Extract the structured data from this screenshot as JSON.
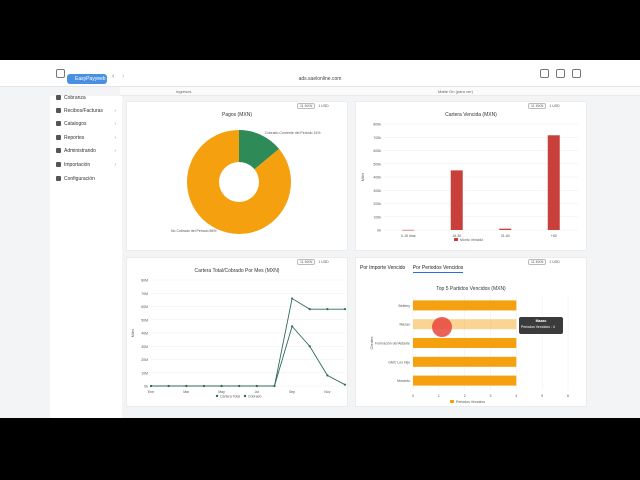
{
  "browser": {
    "tab_label": "EasyPayyeeb",
    "url": "ads.saelonline.com",
    "sub_left": "Ingresos",
    "sub_mid": "Matte On (para ver)"
  },
  "sidebar": {
    "items": [
      {
        "label": "Cobranza"
      },
      {
        "label": "Recibos/Facturas"
      },
      {
        "label": "Catalogos"
      },
      {
        "label": "Reportes"
      },
      {
        "label": "Administrando"
      },
      {
        "label": "Importación"
      },
      {
        "label": "Configuración"
      }
    ]
  },
  "controls": {
    "a": "11 MXN",
    "b": "1 USD"
  },
  "pagos": {
    "title": "Pagos (MXN)",
    "slice_a_label": "Cobrado Corriente del Periodo 14%",
    "slice_b_label": "No Cobrado del Periodo 86%",
    "colors": {
      "a": "#2e8b57",
      "b": "#f5a00e"
    },
    "chart_data": {
      "type": "pie",
      "categories": [
        "Cobrado Corriente del Periodo",
        "No Cobrado del Periodo"
      ],
      "values": [
        14,
        86
      ]
    }
  },
  "cartera": {
    "title": "Cartera Vencida (MXN)",
    "ylabel": "Miles",
    "legend": "Monto Vencido",
    "color": "#c9403b",
    "chart_data": {
      "type": "bar",
      "categories": [
        "0-15 días",
        "16-30",
        "31-60",
        "+60"
      ],
      "values": [
        1,
        450,
        10,
        715
      ],
      "ylim": [
        0,
        800
      ],
      "yticks": [
        "0k",
        "100k",
        "200k",
        "300k",
        "400k",
        "500k",
        "600k",
        "700k",
        "800k"
      ]
    }
  },
  "cartera_total": {
    "title": "Cartera Total/Cobrado Por Mes (MXN)",
    "ylabel": "Miles",
    "legend_a": "Cartera Total",
    "legend_b": "Cobrado",
    "color": "#2f6b5a",
    "chart_data": {
      "type": "line",
      "x": [
        "Ene",
        "Feb",
        "Mar",
        "Abr",
        "May",
        "Jun",
        "Jul",
        "Ago",
        "Sep",
        "Oct",
        "Nov",
        "Dic"
      ],
      "x_ticks": [
        "Ene",
        "Mar",
        "May",
        "Jul",
        "Sep",
        "Nov"
      ],
      "ylim": [
        0,
        8
      ],
      "yticks": [
        "0k",
        "10M",
        "20M",
        "30M",
        "40M",
        "50M",
        "60M",
        "70M",
        "80M"
      ],
      "series": [
        {
          "name": "Cartera Total",
          "values": [
            0,
            0,
            0,
            0,
            0,
            0,
            0,
            0,
            6.6,
            5.8,
            5.8,
            5.8
          ]
        },
        {
          "name": "Cobrado",
          "values": [
            0,
            0,
            0,
            0,
            0,
            0,
            0,
            0,
            4.5,
            3.0,
            0.8,
            0.1
          ]
        }
      ]
    }
  },
  "tabs": {
    "t1": "Por Importe Vencido",
    "t2": "Por Periodos Vencidos"
  },
  "top5": {
    "title": "Top 5 Partidos Vencidos (MXN)",
    "ylabel": "Clientes",
    "legend": "Periodos Vencidos",
    "color": "#f5a00e",
    "chart_data": {
      "type": "bar",
      "categories": [
        "Belleny",
        "Mazao",
        "Formación del Aldante",
        "GMC Los Hijo",
        "Moranto"
      ],
      "values": [
        4,
        4,
        4,
        4,
        4
      ],
      "xlim": [
        0,
        6
      ],
      "xticks": [
        "0",
        "1",
        "2",
        "3",
        "4",
        "5",
        "6"
      ]
    },
    "tooltip_title": "Mazao",
    "tooltip_value": "Periodos Vencidos : 4"
  }
}
